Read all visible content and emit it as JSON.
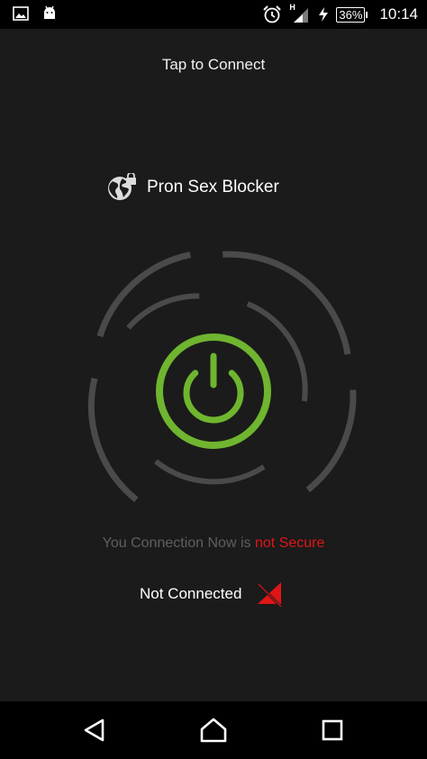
{
  "status_bar": {
    "battery": "36%",
    "time": "10:14",
    "signal_label": "H",
    "left_icons": [
      "image-icon",
      "android-icon"
    ],
    "right_icons": [
      "alarm-icon",
      "signal-icon",
      "charging-icon",
      "battery-icon"
    ]
  },
  "main": {
    "tap_label": "Tap to Connect",
    "brand_title": "Pron Sex Blocker",
    "brand_icon": "globe-lock-icon",
    "power_icon": "power-icon",
    "status_prefix": "You Connection Now is",
    "status_value": "not Secure",
    "connection_label": "Not Connected",
    "connection_icon": "no-signal-icon"
  },
  "colors": {
    "accent_green": "#6fb52f",
    "warning_red": "#e01515",
    "ring_gray": "#4a4a4a",
    "background": "#1b1b1b"
  },
  "nav_bar": {
    "icons": [
      "back-icon",
      "home-icon",
      "recents-icon"
    ]
  }
}
